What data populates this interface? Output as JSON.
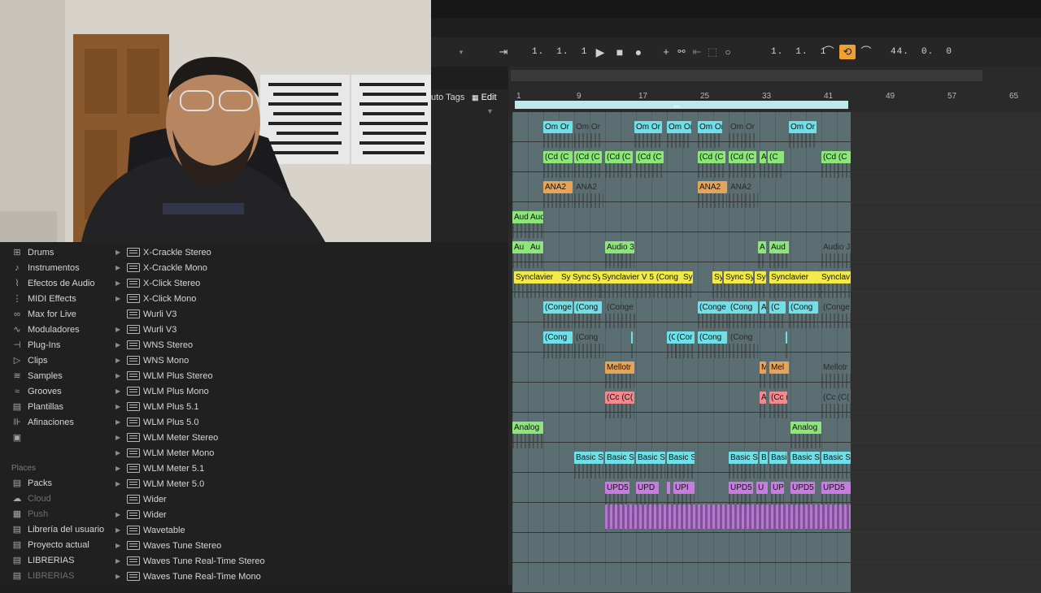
{
  "transport": {
    "pos1": "1.  1.  1",
    "pos2": "1.  1.  1",
    "pos3": "44.  0.  0"
  },
  "toolbar": {
    "auto_tags": "uto Tags",
    "edit": "Edit"
  },
  "ruler": [
    "1",
    "9",
    "17",
    "25",
    "33",
    "41",
    "49",
    "57",
    "65"
  ],
  "categories": [
    {
      "label": "Drums",
      "icon": "drums-icon"
    },
    {
      "label": "Instrumentos",
      "icon": "instrument-icon"
    },
    {
      "label": "Efectos de Audio",
      "icon": "audio-effects-icon"
    },
    {
      "label": "MIDI Effects",
      "icon": "midi-effects-icon"
    },
    {
      "label": "Max for Live",
      "icon": "max-icon"
    },
    {
      "label": "Moduladores",
      "icon": "modulators-icon"
    },
    {
      "label": "Plug-Ins",
      "icon": "plugins-icon"
    },
    {
      "label": "Clips",
      "icon": "clips-icon"
    },
    {
      "label": "Samples",
      "icon": "samples-icon"
    },
    {
      "label": "Grooves",
      "icon": "grooves-icon"
    },
    {
      "label": "Plantillas",
      "icon": "templates-icon"
    },
    {
      "label": "Afinaciones",
      "icon": "tunings-icon"
    },
    {
      "label": "",
      "icon": "image-icon"
    }
  ],
  "places_header": "Places",
  "places": [
    {
      "label": "Packs",
      "dim": false
    },
    {
      "label": "Cloud",
      "dim": true
    },
    {
      "label": "Push",
      "dim": true
    },
    {
      "label": "Librería del usuario",
      "dim": false
    },
    {
      "label": "Proyecto actual",
      "dim": false
    },
    {
      "label": "LIBRERIAS",
      "dim": false
    },
    {
      "label": "LIBRERIAS",
      "dim": true
    }
  ],
  "devices": [
    {
      "label": "X-Crackle Stereo",
      "tri": true
    },
    {
      "label": "X-Crackle Mono",
      "tri": true
    },
    {
      "label": "X-Click Stereo",
      "tri": true
    },
    {
      "label": "X-Click Mono",
      "tri": true
    },
    {
      "label": "Wurli V3",
      "tri": false
    },
    {
      "label": "Wurli V3",
      "tri": true
    },
    {
      "label": "WNS Stereo",
      "tri": true
    },
    {
      "label": "WNS Mono",
      "tri": true
    },
    {
      "label": "WLM Plus Stereo",
      "tri": true
    },
    {
      "label": "WLM Plus Mono",
      "tri": true
    },
    {
      "label": "WLM Plus 5.1",
      "tri": true
    },
    {
      "label": "WLM Plus 5.0",
      "tri": true
    },
    {
      "label": "WLM Meter Stereo",
      "tri": true
    },
    {
      "label": "WLM Meter Mono",
      "tri": true
    },
    {
      "label": "WLM Meter 5.1",
      "tri": true
    },
    {
      "label": "WLM Meter 5.0",
      "tri": true
    },
    {
      "label": "Wider",
      "tri": false
    },
    {
      "label": "Wider",
      "tri": true
    },
    {
      "label": "Wavetable",
      "tri": true
    },
    {
      "label": "Waves Tune Stereo",
      "tri": true
    },
    {
      "label": "Waves Tune Real-Time Stereo",
      "tri": true
    },
    {
      "label": "Waves Tune Real-Time Mono",
      "tri": true
    }
  ],
  "clips": {
    "om": "Om Or",
    "cd": "(Cd (C",
    "ana2": "ANA2",
    "aud": "Aud",
    "audio3": "Audio 3",
    "audio_j": "Audio J",
    "sync": "Synclavier",
    "syncv5": "Synclavier V 5 (Cong",
    "synclav": "Synclav",
    "conga": "(Conge",
    "cong": "(Cong",
    "mellotr": "Mellotr",
    "mel": "Mel",
    "ccc": "(Cc (C(",
    "analog": "Analog",
    "basic": "Basic S",
    "upd5": "UPD5",
    "upd": "UPD",
    "small_a": "A",
    "small_m": "M",
    "small_s": "Sy",
    "small_b": "B",
    "small_u": "U",
    "up": "UP",
    "upi": "UPI",
    "bas": "Basi",
    "cc": "(C",
    "cor": "(Cor",
    "au": "Au",
    "syn": "Sync"
  },
  "colors": {
    "cyan": "#6fe0e8",
    "green": "#8ce67a",
    "orange": "#e7a357",
    "yellow": "#f2e94a",
    "pink": "#f08a8f",
    "purple": "#c77de0",
    "loop": "#bfe7ee",
    "accent": "#f0a030"
  }
}
